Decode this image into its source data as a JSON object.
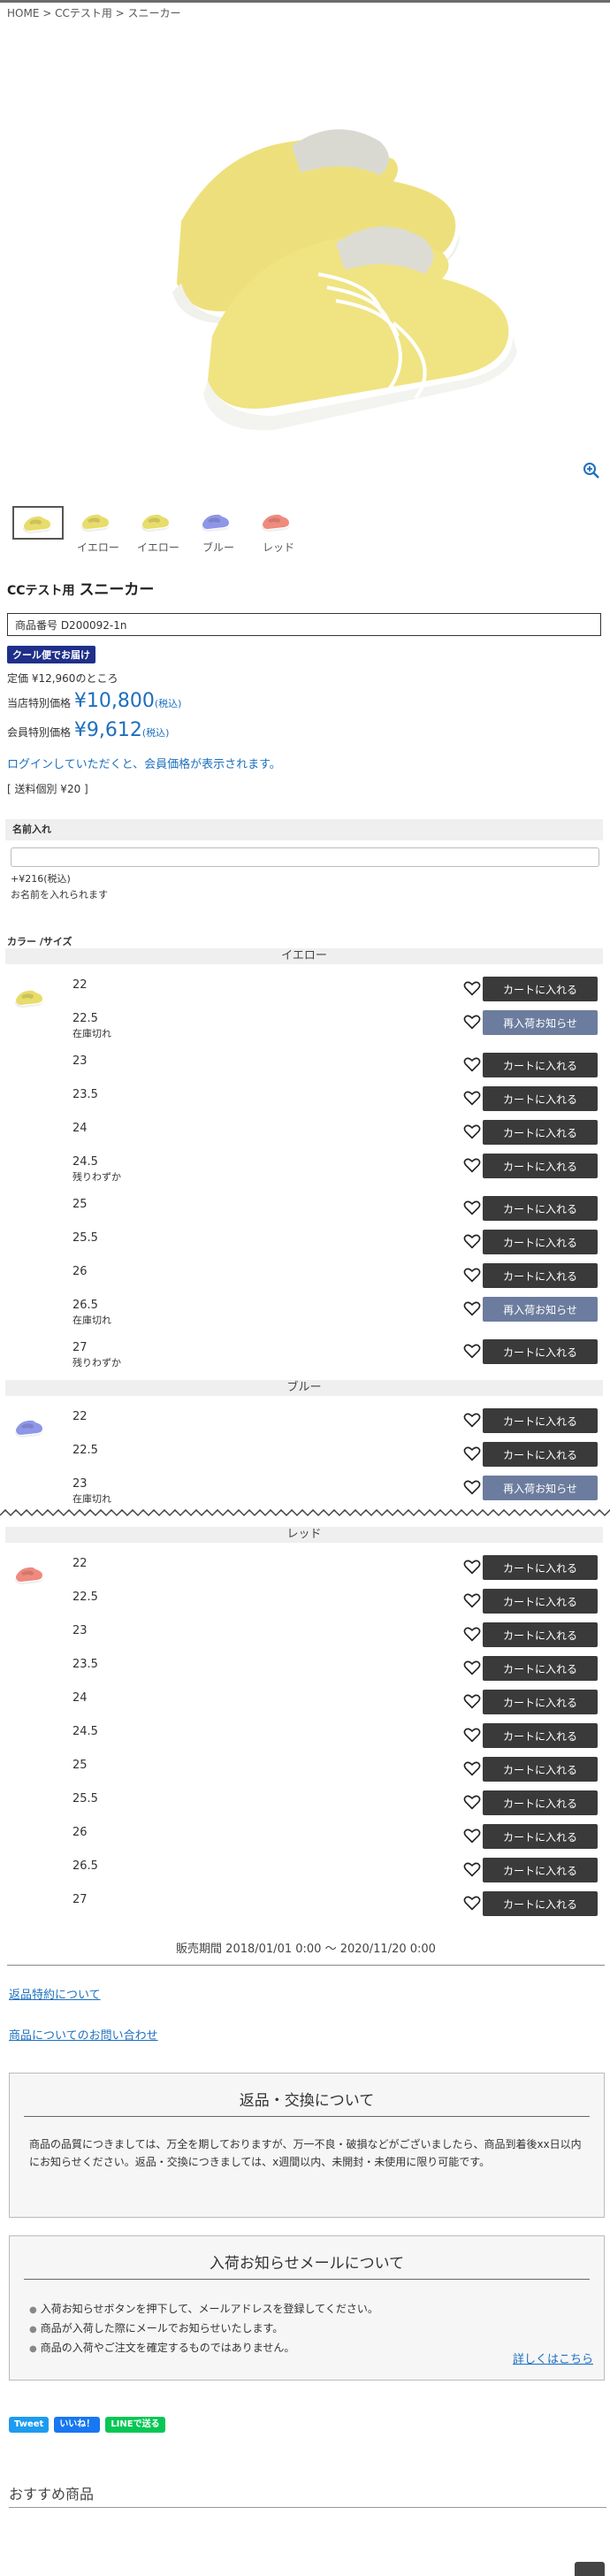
{
  "breadcrumb": {
    "home": "HOME",
    "sep1": " > ",
    "category": "CCテスト用",
    "sep2": " > ",
    "current": "スニーカー"
  },
  "hero": {
    "alt": "yellow sneakers",
    "zoom_icon": "zoom-in-icon"
  },
  "thumbnails": [
    {
      "label": "",
      "color": "#e8dc6a",
      "selected": true
    },
    {
      "label": "イエロー",
      "color": "#e8dc6a",
      "selected": false
    },
    {
      "label": "イエロー",
      "color": "#e8dc6a",
      "selected": false
    },
    {
      "label": "ブルー",
      "color": "#8e96e8",
      "selected": false
    },
    {
      "label": "レッド",
      "color": "#ef8a7e",
      "selected": false
    }
  ],
  "product": {
    "brand": "CCテスト用",
    "name": "スニーカー",
    "code": "商品番号 D200092-1n",
    "badge": "クール便でお届け",
    "teika": "定価 ¥12,960のところ",
    "shop_label": "当店特別価格",
    "shop_price": "¥10,800",
    "shop_tax": "(税込)",
    "member_label": "会員特別価格",
    "member_price": "¥9,612",
    "member_tax": "(税込)",
    "login_note": "ログインしていただくと、会員価格が表示されます。",
    "shipping": "[ 送料個別 ¥20 ]"
  },
  "name_option": {
    "label": "名前入れ",
    "price": "+¥216(税込)",
    "hint": "お名前を入れられます"
  },
  "color_size_label": "カラー /サイズ",
  "variants": [
    {
      "color": "イエロー",
      "swatch": "#e8dc6a",
      "rows": [
        {
          "size": "22",
          "status": "",
          "button": "カートに入れる",
          "type": "cart"
        },
        {
          "size": "22.5",
          "status": "在庫切れ",
          "button": "再入荷お知らせ",
          "type": "notify"
        },
        {
          "size": "23",
          "status": "",
          "button": "カートに入れる",
          "type": "cart"
        },
        {
          "size": "23.5",
          "status": "",
          "button": "カートに入れる",
          "type": "cart"
        },
        {
          "size": "24",
          "status": "",
          "button": "カートに入れる",
          "type": "cart"
        },
        {
          "size": "24.5",
          "status": "残りわずか",
          "button": "カートに入れる",
          "type": "cart"
        },
        {
          "size": "25",
          "status": "",
          "button": "カートに入れる",
          "type": "cart"
        },
        {
          "size": "25.5",
          "status": "",
          "button": "カートに入れる",
          "type": "cart"
        },
        {
          "size": "26",
          "status": "",
          "button": "カートに入れる",
          "type": "cart"
        },
        {
          "size": "26.5",
          "status": "在庫切れ",
          "button": "再入荷お知らせ",
          "type": "notify"
        },
        {
          "size": "27",
          "status": "残りわずか",
          "button": "カートに入れる",
          "type": "cart"
        }
      ]
    },
    {
      "color": "ブルー",
      "swatch": "#8e96e8",
      "rows": [
        {
          "size": "22",
          "status": "",
          "button": "カートに入れる",
          "type": "cart"
        },
        {
          "size": "22.5",
          "status": "",
          "button": "カートに入れる",
          "type": "cart"
        },
        {
          "size": "23",
          "status": "在庫切れ",
          "button": "再入荷お知らせ",
          "type": "notify"
        }
      ]
    },
    {
      "color": "レッド",
      "swatch": "#ef8a7e",
      "rows": [
        {
          "size": "22",
          "status": "",
          "button": "カートに入れる",
          "type": "cart"
        },
        {
          "size": "22.5",
          "status": "",
          "button": "カートに入れる",
          "type": "cart"
        },
        {
          "size": "23",
          "status": "",
          "button": "カートに入れる",
          "type": "cart"
        },
        {
          "size": "23.5",
          "status": "",
          "button": "カートに入れる",
          "type": "cart"
        },
        {
          "size": "24",
          "status": "",
          "button": "カートに入れる",
          "type": "cart"
        },
        {
          "size": "24.5",
          "status": "",
          "button": "カートに入れる",
          "type": "cart"
        },
        {
          "size": "25",
          "status": "",
          "button": "カートに入れる",
          "type": "cart"
        },
        {
          "size": "25.5",
          "status": "",
          "button": "カートに入れる",
          "type": "cart"
        },
        {
          "size": "26",
          "status": "",
          "button": "カートに入れる",
          "type": "cart"
        },
        {
          "size": "26.5",
          "status": "",
          "button": "カートに入れる",
          "type": "cart"
        },
        {
          "size": "27",
          "status": "",
          "button": "カートに入れる",
          "type": "cart"
        }
      ]
    }
  ],
  "sales_period": "販売期間 2018/01/01 0:00 〜 2020/11/20 0:00",
  "links": {
    "returns": "返品特約について",
    "inquiry": "商品についてのお問い合わせ"
  },
  "returns_box": {
    "title": "返品・交換について",
    "body": "商品の品質につきましては、万全を期しておりますが、万一不良・破損などがございましたら、商品到着後xx日以内にお知らせください。返品・交換につきましては、x週間以内、未開封・未使用に限り可能です。"
  },
  "notice_box": {
    "title": "入荷お知らせメールについて",
    "items": [
      "入荷お知らせボタンを押下して、メールアドレスを登録してください。",
      "商品が入荷した際にメールでお知らせいたします。",
      "商品の入荷やご注文を確定するものではありません。"
    ],
    "more": "詳しくはこちら"
  },
  "share": {
    "tweet": "Tweet",
    "like": "いいね！",
    "line": "LINEで送る"
  },
  "recommend_title": "おすすめ商品",
  "colors": {
    "accent": "#1e6fbf",
    "cart_button": "#3a3a3a",
    "notify_button": "#6c7c9e",
    "badge": "#1f2f8a"
  }
}
